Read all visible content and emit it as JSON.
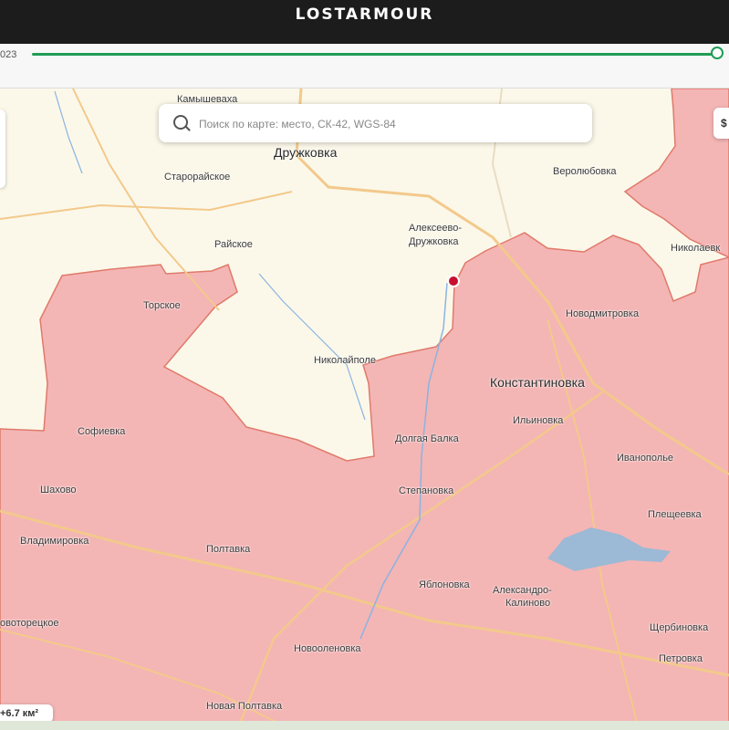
{
  "header": {
    "logo": "LOSTARMOUR"
  },
  "timeline": {
    "date_label": "023",
    "progress_percent": 100
  },
  "search": {
    "placeholder": "Поиск по карте: место, СК-42, WGS-84"
  },
  "right_button": {
    "label": "$"
  },
  "area_badge": {
    "label": "+6.7 км²"
  },
  "colors": {
    "occupied": "#f4b5b5",
    "border": "#e07a6a",
    "land": "#fbf8ea",
    "road": "#f3c98b",
    "accent": "#1f9d55",
    "marker": "#c8102e"
  },
  "places": {
    "kamyshevakha": "Камышеваха",
    "druzhkovka": "Дружковка",
    "staroraiskoe": "Старорайское",
    "veroliubovka": "Веролюбовка",
    "alekseevo": "Алексеево-",
    "alekseevo2": "Дружковка",
    "raiskoe": "Райское",
    "nikolaevka": "Николаевк",
    "torskoe": "Торское",
    "novodmitrovka": "Новодмитровка",
    "nikolaipole": "Николайполе",
    "konstantinovka": "Константиновка",
    "ilinovka": "Ильиновка",
    "sofievka": "Софиевка",
    "dolgaya_balka": "Долгая Балка",
    "ivanopole": "Иванополье",
    "shakhovo": "Шахово",
    "stepanovka": "Степановка",
    "pleshcheevka": "Плещеевка",
    "vladimirovka": "Владимировка",
    "poltavka": "Полтавка",
    "yablonovka": "Яблоновка",
    "aleksandro": "Александро-",
    "aleksandro2": "Калиново",
    "novotoretskoe": "овоторецкое",
    "shcherbinovka": "Щербиновка",
    "novoolenovka": "Новооленовка",
    "petrovka": "Петровка",
    "novaya_poltavka": "Новая Полтавка"
  }
}
